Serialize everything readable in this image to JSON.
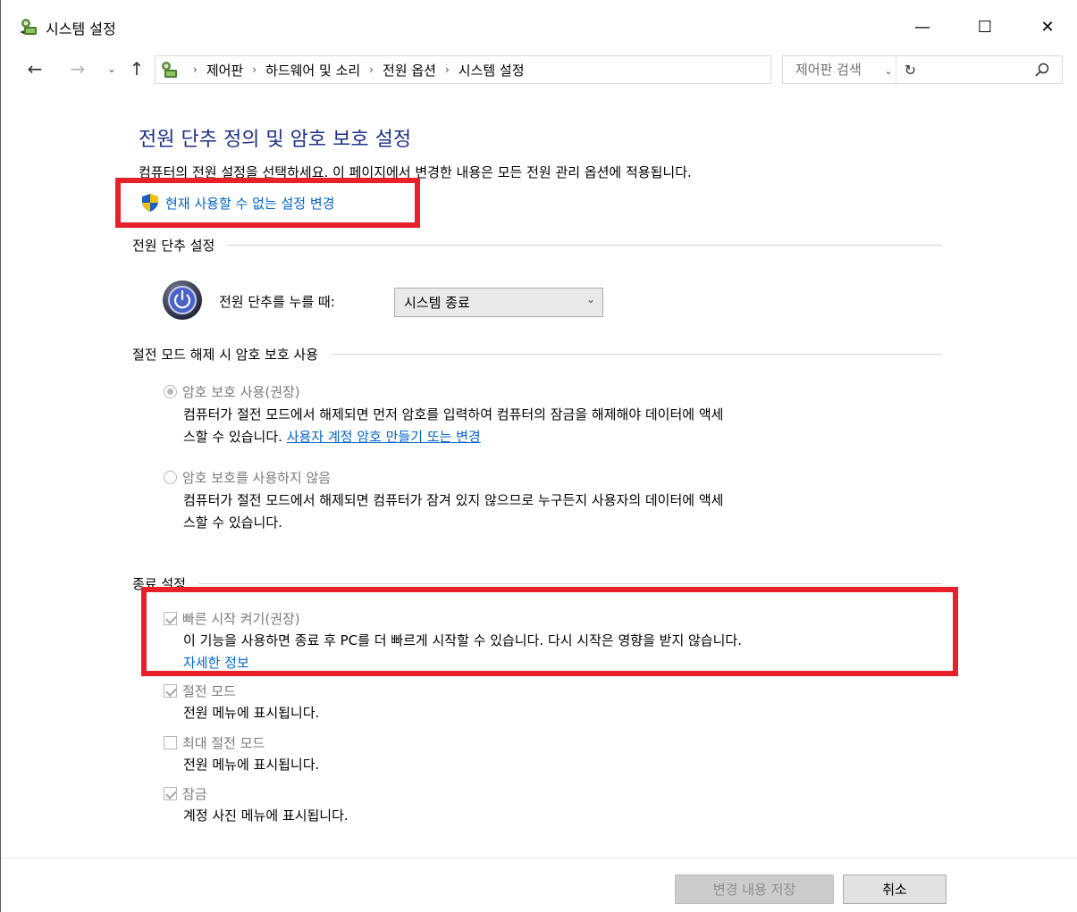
{
  "window": {
    "title": "시스템 설정",
    "minimize_glyph": "—",
    "maximize_glyph": "☐",
    "close_glyph": "✕"
  },
  "nav": {
    "back_glyph": "←",
    "forward_glyph": "→",
    "recent_glyph": "⌄",
    "up_glyph": "↑",
    "breadcrumbs": [
      "제어판",
      "하드웨어 및 소리",
      "전원 옵션",
      "시스템 설정"
    ],
    "dropdown_glyph": "⌄",
    "refresh_glyph": "↻",
    "search_placeholder": "제어판 검색"
  },
  "main": {
    "title": "전원 단추 정의 및 암호 보호 설정",
    "description": "컴퓨터의 전원 설정을 선택하세요. 이 페이지에서 변경한 내용은 모든 전원 관리 옵션에 적용됩니다.",
    "admin_link": "현재 사용할 수 없는 설정 변경"
  },
  "power_button": {
    "section_label": "전원 단추 설정",
    "label": "전원 단추를 누를 때:",
    "selected_value": "시스템 종료"
  },
  "wake_password": {
    "section_label": "절전 모드 해제 시 암호 보호 사용",
    "options": [
      {
        "label": "암호 보호 사용(권장)",
        "selected": true,
        "line1": "컴퓨터가 절전 모드에서 해제되면 먼저 암호를 입력하여 컴퓨터의 잠금을 해제해야 데이터에 액세",
        "line2": "스할 수 있습니다.",
        "link": "사용자 계정 암호 만들기 또는 변경"
      },
      {
        "label": "암호 보호를 사용하지 않음",
        "selected": false,
        "line1": "컴퓨터가 절전 모드에서 해제되면 컴퓨터가 잠겨 있지 않으므로 누구든지 사용자의 데이터에 액세",
        "line2": "스할 수 있습니다."
      }
    ]
  },
  "shutdown": {
    "section_label": "종료 설정",
    "options": [
      {
        "label": "빠른 시작 켜기(권장)",
        "checked": true,
        "description": "이 기능을 사용하면 종료 후 PC를 더 빠르게 시작할 수 있습니다. 다시 시작은 영향을 받지 않습니다.",
        "link": "자세한 정보"
      },
      {
        "label": "절전 모드",
        "checked": true,
        "description": "전원 메뉴에 표시됩니다."
      },
      {
        "label": "최대 절전 모드",
        "checked": false,
        "description": "전원 메뉴에 표시됩니다."
      },
      {
        "label": "잠금",
        "checked": true,
        "description": "계정 사진 메뉴에 표시됩니다."
      }
    ]
  },
  "footer": {
    "save_label": "변경 내용 저장",
    "cancel_label": "취소"
  },
  "colors": {
    "title_blue": "#1e3287",
    "link_blue": "#0066cc",
    "highlight_red": "#e8202a"
  }
}
